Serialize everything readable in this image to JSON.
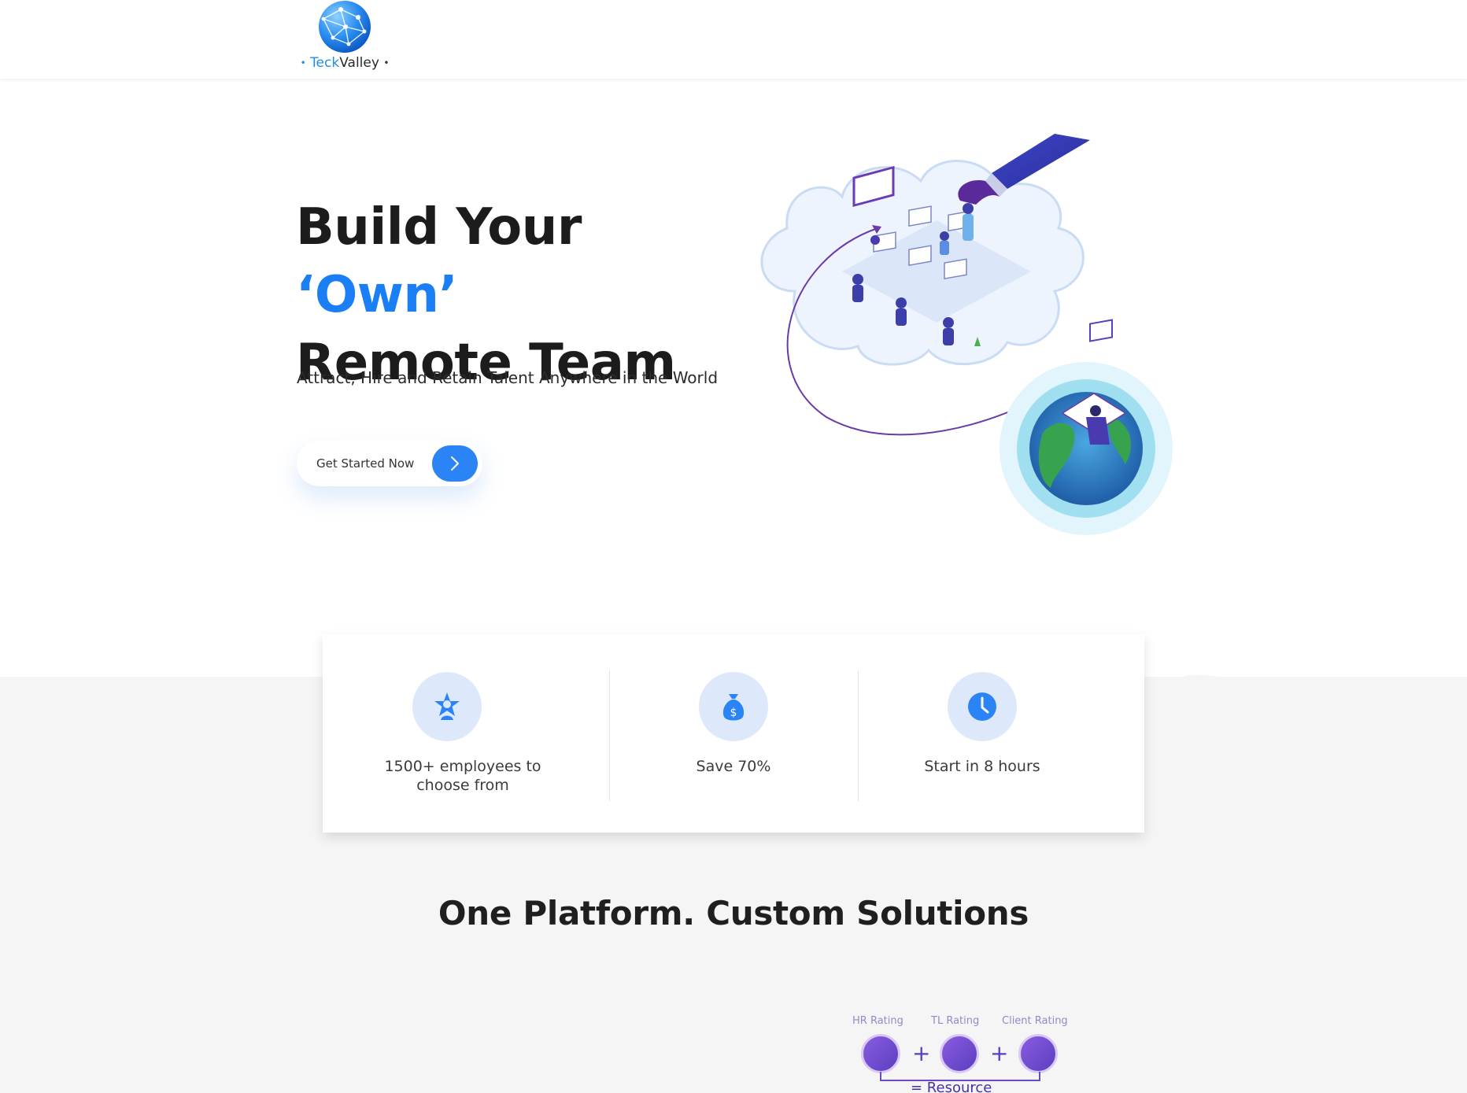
{
  "header": {
    "logo": {
      "prefix": "Teck",
      "suffix": "Valley",
      "dot": "•"
    }
  },
  "hero": {
    "title_part1": "Build Your ",
    "title_accent": "‘Own’",
    "title_part2": "Remote Team",
    "subtitle": "Attract, Hire and Retain Talent Anywhere in the World",
    "cta_label": "Get Started Now",
    "cta_icon": "chevron-right-icon"
  },
  "features": [
    {
      "icon": "star-person-icon",
      "text": "1500+ employees to choose from"
    },
    {
      "icon": "money-bag-icon",
      "text": "Save 70%"
    },
    {
      "icon": "clock-icon",
      "text": "Start in 8 hours"
    }
  ],
  "solutions": {
    "title": "One Platform. Custom Solutions",
    "ratings": [
      {
        "label": "HR Rating"
      },
      {
        "label": "TL Rating"
      },
      {
        "label": "Client Rating"
      }
    ],
    "plus": "+",
    "result": "= Resource"
  },
  "colors": {
    "accent": "#1a7ff5",
    "button": "#2a84f5",
    "feature_icon_bg": "#dde9fb",
    "rating_purple": "#5a3fbf",
    "page_grey": "#f5f5f5"
  }
}
